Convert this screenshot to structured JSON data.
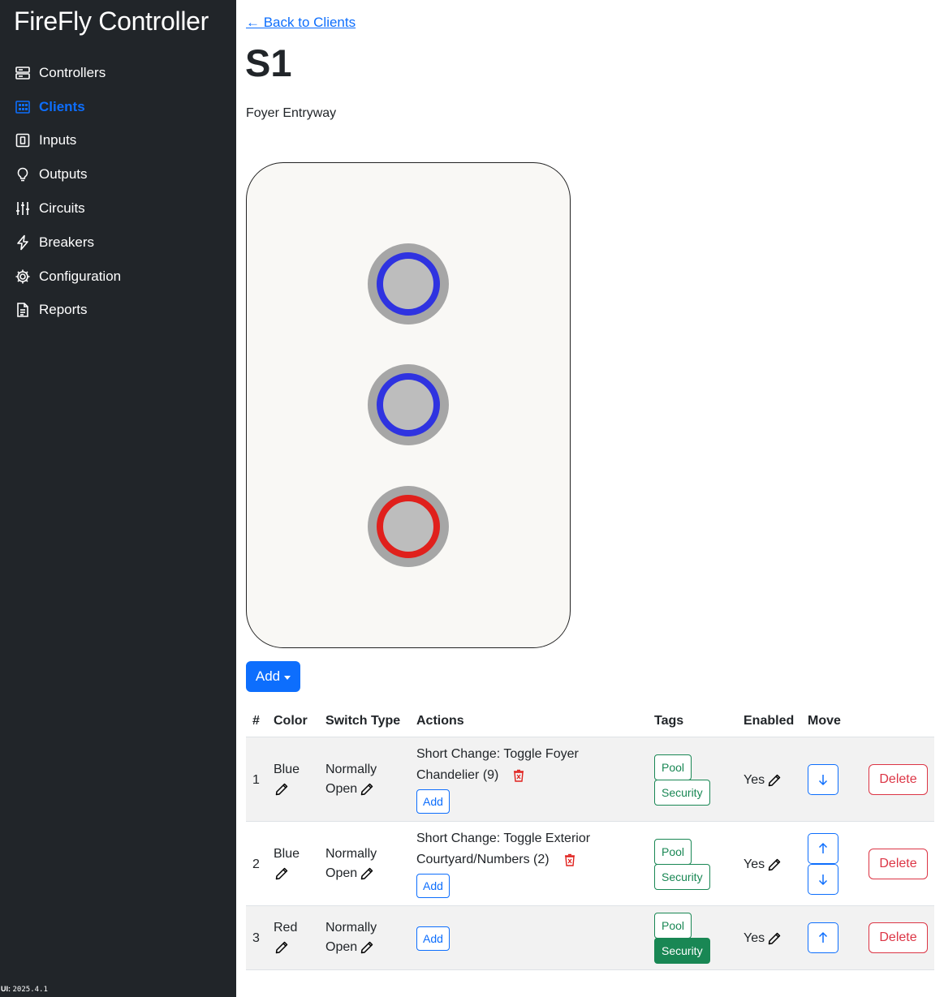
{
  "app": {
    "brand": "FireFly Controller",
    "version_label": "UI:",
    "version_value": "2025.4.1"
  },
  "colors": {
    "sidebar_bg": "#212529",
    "accent": "#0d6efd",
    "success": "#198754",
    "danger": "#dc3545",
    "led_blue": "#2f33e0",
    "led_red": "#e0201c"
  },
  "nav": [
    {
      "label": "Controllers",
      "icon": "server-icon"
    },
    {
      "label": "Clients",
      "icon": "grid-icon",
      "active": true
    },
    {
      "label": "Inputs",
      "icon": "input-square-icon"
    },
    {
      "label": "Outputs",
      "icon": "lightbulb-icon"
    },
    {
      "label": "Circuits",
      "icon": "sliders-icon"
    },
    {
      "label": "Breakers",
      "icon": "lightning-icon"
    },
    {
      "label": "Configuration",
      "icon": "gear-icon"
    },
    {
      "label": "Reports",
      "icon": "document-icon"
    }
  ],
  "page": {
    "back_link": "← Back to Clients",
    "title": "S1",
    "description": "Foyer Entryway",
    "add_button": "Add"
  },
  "switch_plate": {
    "buttons": [
      {
        "color": "blue"
      },
      {
        "color": "blue"
      },
      {
        "color": "red"
      }
    ]
  },
  "table": {
    "headers": {
      "num": "#",
      "color": "Color",
      "switch_type": "Switch Type",
      "actions": "Actions",
      "tags": "Tags",
      "enabled": "Enabled",
      "move": "Move"
    },
    "rows": [
      {
        "num": "1",
        "color": "Blue",
        "switch_type_1": "Normally",
        "switch_type_2": "Open",
        "action_1": "Short Change: Toggle Foyer",
        "action_2": "Chandelier (9)",
        "action_add": "Add",
        "tag_1": "Pool",
        "tag_2": "Security",
        "enabled": "Yes",
        "delete": "Delete"
      },
      {
        "num": "2",
        "color": "Blue",
        "switch_type_1": "Normally",
        "switch_type_2": "Open",
        "action_1": "Short Change: Toggle Exterior",
        "action_2": "Courtyard/Numbers (2)",
        "action_add": "Add",
        "tag_1": "Pool",
        "tag_2": "Security",
        "enabled": "Yes",
        "delete": "Delete"
      },
      {
        "num": "3",
        "color": "Red",
        "switch_type_1": "Normally",
        "switch_type_2": "Open",
        "action_add": "Add",
        "tag_1": "Pool",
        "tag_2": "Security",
        "tag_2_selected": true,
        "enabled": "Yes",
        "delete": "Delete"
      }
    ]
  }
}
